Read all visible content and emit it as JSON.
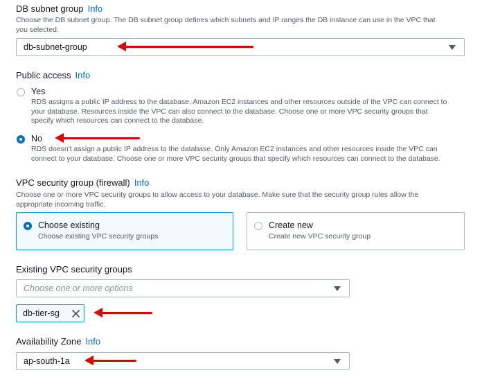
{
  "db_subnet": {
    "title": "DB subnet group",
    "info": "Info",
    "description_line1": "Choose the DB subnet group. The DB subnet group defines which subnets and IP ranges the DB instance can use in the VPC that",
    "description_line2": "you selected.",
    "selected": "db-subnet-group"
  },
  "public_access": {
    "title": "Public access",
    "info": "Info",
    "yes": {
      "label": "Yes",
      "desc_line1": "RDS assigns a public IP address to the database. Amazon EC2 instances and other resources outside of the VPC can connect to",
      "desc_line2": "your database. Resources inside the VPC can also connect to the database. Choose one or more VPC security groups that",
      "desc_line3": "specify which resources can connect to the database.",
      "selected": false
    },
    "no": {
      "label": "No",
      "desc_line1": "RDS doesn't assign a public IP address to the database. Only Amazon EC2 instances and other resources inside the VPC can",
      "desc_line2": "connect to your database. Choose one or more VPC security groups that specify which resources can connect to the database.",
      "selected": true
    }
  },
  "vpc_sg": {
    "title": "VPC security group (firewall)",
    "info": "Info",
    "desc_line1": "Choose one or more VPC security groups to allow access to your database. Make sure that the security group rules allow the",
    "desc_line2": "appropriate incoming traffic.",
    "choose_existing": {
      "label": "Choose existing",
      "desc": "Choose existing VPC security groups",
      "selected": true
    },
    "create_new": {
      "label": "Create new",
      "desc": "Create new VPC security group",
      "selected": false
    }
  },
  "existing_sg": {
    "title": "Existing VPC security groups",
    "placeholder": "Choose one or more options",
    "token": "db-tier-sg"
  },
  "az": {
    "title": "Availability Zone",
    "info": "Info",
    "selected": "ap-south-1a"
  },
  "colors": {
    "link": "#0073bb",
    "selected_border": "#00a1c9",
    "annotation_arrow": "#e00000"
  },
  "icons": [
    "caret-down-icon",
    "close-icon",
    "annotation-arrow"
  ]
}
